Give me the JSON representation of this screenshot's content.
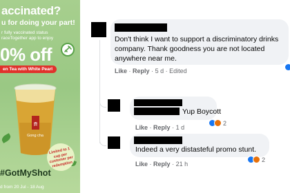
{
  "promo": {
    "title": "accinated?",
    "subtitle": "u for doing your part!",
    "body_line1": "r fully vaccinated status",
    "body_line2": "raceTogether app to enjoy",
    "offer": "0% off",
    "drink": "en Tea with White Pearl",
    "limit_text": "Limited to 1 cup per customer per redemption",
    "hashtag": "GotMyShot",
    "validity": "d from 20 Jul - 18 Aug",
    "brand": "Gong cha",
    "colors": {
      "background": "#a7cf8e",
      "accent": "#e0322c",
      "cup": "#d9a534"
    }
  },
  "comments": [
    {
      "text": "Don't think I want to support a discriminatory drinks company. Thank goodness you are not located anywhere near me.",
      "actions": {
        "like": "Like",
        "reply": "Reply",
        "age": "5 d",
        "edited": "Edited"
      }
    },
    {
      "text": "Yup Boycott",
      "actions": {
        "like": "Like",
        "reply": "Reply",
        "age": "1 d"
      },
      "reaction_count": "2"
    },
    {
      "text": "Indeed a very distasteful promo stunt.",
      "actions": {
        "like": "Like",
        "reply": "Reply",
        "age": "21 h"
      },
      "reaction_count": "2"
    }
  ],
  "separator": "·",
  "icons": [
    "like-reaction-icon",
    "angry-reaction-icon"
  ]
}
